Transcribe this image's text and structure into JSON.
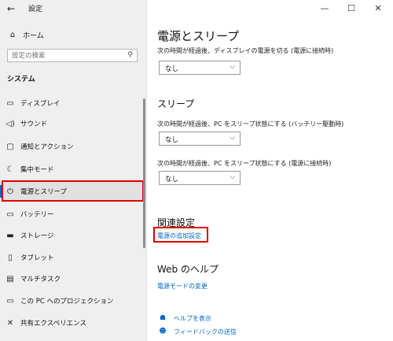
{
  "window": {
    "title": "設定"
  },
  "sidebar": {
    "home_label": "ホーム",
    "search_placeholder": "設定の検索",
    "section_title": "システム",
    "items": [
      {
        "label": "ディスプレイ",
        "icon": "display-icon"
      },
      {
        "label": "サウンド",
        "icon": "speaker-icon"
      },
      {
        "label": "通知とアクション",
        "icon": "notification-icon"
      },
      {
        "label": "集中モード",
        "icon": "moon-icon"
      },
      {
        "label": "電源とスリープ",
        "icon": "power-icon",
        "active": true
      },
      {
        "label": "バッテリー",
        "icon": "battery-icon"
      },
      {
        "label": "ストレージ",
        "icon": "storage-icon"
      },
      {
        "label": "タブレット",
        "icon": "tablet-icon"
      },
      {
        "label": "マルチタスク",
        "icon": "multitask-icon"
      },
      {
        "label": "この PC へのプロジェクション",
        "icon": "projection-icon"
      },
      {
        "label": "共有エクスペリエンス",
        "icon": "shared-icon"
      }
    ]
  },
  "main": {
    "page_title": "電源とスリープ",
    "screen": {
      "label": "次の時間が経過後、ディスプレイの電源を切る (電源に接続時)",
      "value": "なし"
    },
    "sleep": {
      "heading": "スリープ",
      "battery_label": "次の時間が経過後、PC をスリープ状態にする (バッテリー駆動時)",
      "battery_value": "なし",
      "plugged_label": "次の時間が経過後、PC をスリープ状態にする (電源に接続時)",
      "plugged_value": "なし"
    },
    "related": {
      "heading": "関連設定",
      "link": "電源の追加設定"
    },
    "web_help": {
      "heading": "Web のヘルプ",
      "link": "電源モードの変更"
    },
    "help_links": [
      {
        "label": "ヘルプを表示",
        "icon": "help-icon"
      },
      {
        "label": "フィードバックの送信",
        "icon": "feedback-icon"
      }
    ]
  },
  "colors": {
    "accent": "#0067c0",
    "highlight": "#e00000"
  }
}
